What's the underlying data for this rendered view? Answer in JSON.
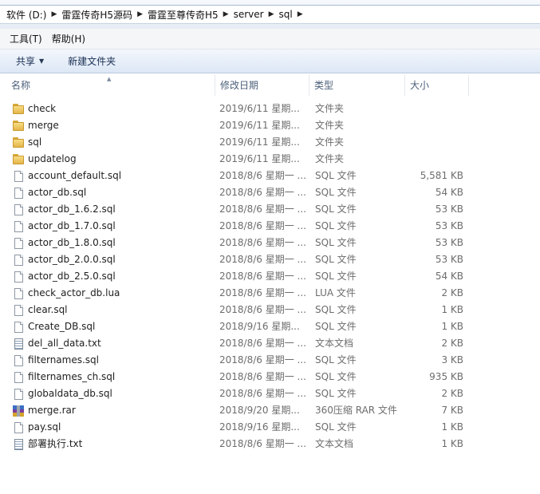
{
  "address": {
    "crumbs": [
      "软件 (D:)",
      "雷霆传奇H5源码",
      "雷霆至尊传奇H5",
      "server",
      "sql"
    ]
  },
  "menu": {
    "tools": "工具(T)",
    "help": "帮助(H)"
  },
  "commands": {
    "share": "共享",
    "new_folder": "新建文件夹"
  },
  "columns": {
    "name": "名称",
    "date": "修改日期",
    "type": "类型",
    "size": "大小"
  },
  "files": [
    {
      "name": "check",
      "date": "2019/6/11 星期...",
      "type": "文件夹",
      "size": "",
      "icon": "folder-icon"
    },
    {
      "name": "merge",
      "date": "2019/6/11 星期...",
      "type": "文件夹",
      "size": "",
      "icon": "folder-icon"
    },
    {
      "name": "sql",
      "date": "2019/6/11 星期...",
      "type": "文件夹",
      "size": "",
      "icon": "folder-icon"
    },
    {
      "name": "updatelog",
      "date": "2019/6/11 星期...",
      "type": "文件夹",
      "size": "",
      "icon": "folder-icon"
    },
    {
      "name": "account_default.sql",
      "date": "2018/8/6 星期一 ...",
      "type": "SQL 文件",
      "size": "5,581 KB",
      "icon": "file-icon"
    },
    {
      "name": "actor_db.sql",
      "date": "2018/8/6 星期一 ...",
      "type": "SQL 文件",
      "size": "54 KB",
      "icon": "file-icon"
    },
    {
      "name": "actor_db_1.6.2.sql",
      "date": "2018/8/6 星期一 ...",
      "type": "SQL 文件",
      "size": "53 KB",
      "icon": "file-icon"
    },
    {
      "name": "actor_db_1.7.0.sql",
      "date": "2018/8/6 星期一 ...",
      "type": "SQL 文件",
      "size": "53 KB",
      "icon": "file-icon"
    },
    {
      "name": "actor_db_1.8.0.sql",
      "date": "2018/8/6 星期一 ...",
      "type": "SQL 文件",
      "size": "53 KB",
      "icon": "file-icon"
    },
    {
      "name": "actor_db_2.0.0.sql",
      "date": "2018/8/6 星期一 ...",
      "type": "SQL 文件",
      "size": "53 KB",
      "icon": "file-icon"
    },
    {
      "name": "actor_db_2.5.0.sql",
      "date": "2018/8/6 星期一 ...",
      "type": "SQL 文件",
      "size": "54 KB",
      "icon": "file-icon"
    },
    {
      "name": "check_actor_db.lua",
      "date": "2018/8/6 星期一 ...",
      "type": "LUA 文件",
      "size": "2 KB",
      "icon": "file-icon"
    },
    {
      "name": "clear.sql",
      "date": "2018/8/6 星期一 ...",
      "type": "SQL 文件",
      "size": "1 KB",
      "icon": "file-icon"
    },
    {
      "name": "Create_DB.sql",
      "date": "2018/9/16 星期...",
      "type": "SQL 文件",
      "size": "1 KB",
      "icon": "file-icon"
    },
    {
      "name": "del_all_data.txt",
      "date": "2018/8/6 星期一 ...",
      "type": "文本文档",
      "size": "2 KB",
      "icon": "text-document-icon"
    },
    {
      "name": "filternames.sql",
      "date": "2018/8/6 星期一 ...",
      "type": "SQL 文件",
      "size": "3 KB",
      "icon": "file-icon"
    },
    {
      "name": "filternames_ch.sql",
      "date": "2018/8/6 星期一 ...",
      "type": "SQL 文件",
      "size": "935 KB",
      "icon": "file-icon"
    },
    {
      "name": "globaldata_db.sql",
      "date": "2018/8/6 星期一 ...",
      "type": "SQL 文件",
      "size": "2 KB",
      "icon": "file-icon"
    },
    {
      "name": "merge.rar",
      "date": "2018/9/20 星期...",
      "type": "360压缩 RAR 文件",
      "size": "7 KB",
      "icon": "rar-archive-icon"
    },
    {
      "name": "pay.sql",
      "date": "2018/9/16 星期...",
      "type": "SQL 文件",
      "size": "1 KB",
      "icon": "file-icon"
    },
    {
      "name": "部署执行.txt",
      "date": "2018/8/6 星期一 ...",
      "type": "文本文档",
      "size": "1 KB",
      "icon": "text-document-icon"
    }
  ]
}
